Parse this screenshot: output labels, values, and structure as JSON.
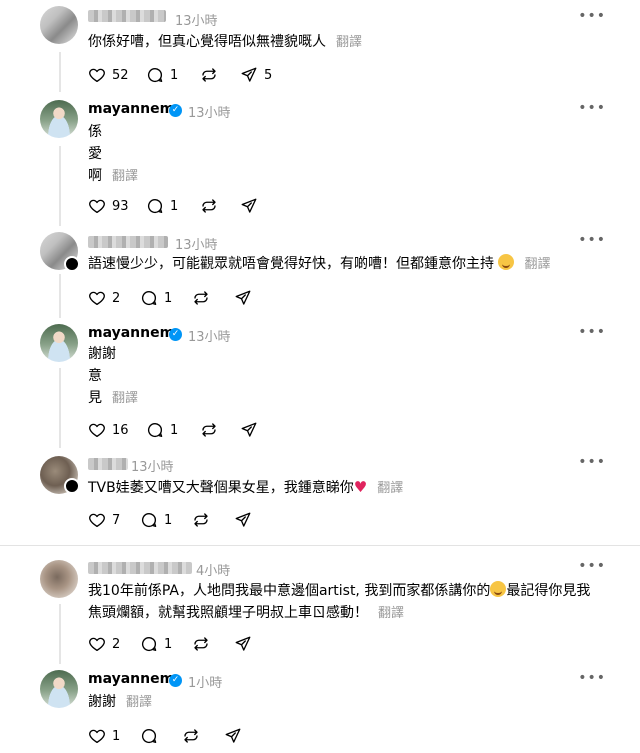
{
  "posts": [
    {
      "time": "13小時",
      "text": "你係好嘈，但真心覺得唔似無禮貌嘅人",
      "translate": "翻譯",
      "likes": "52",
      "comments": "1",
      "shares": "5"
    },
    {
      "user": "mayannem",
      "time": "13小時",
      "lines": [
        "係",
        "愛",
        "啊"
      ],
      "translate": "翻譯",
      "likes": "93",
      "comments": "1"
    },
    {
      "time": "13小時",
      "text": "語速慢少少，可能觀眾就唔會覺得好快，有啲嘈！但都鍾意你主持",
      "translate": "翻譯",
      "likes": "2",
      "comments": "1"
    },
    {
      "user": "mayannem",
      "time": "13小時",
      "lines": [
        "謝謝",
        "意",
        "見"
      ],
      "translate": "翻譯",
      "likes": "16",
      "comments": "1"
    },
    {
      "time": "13小時",
      "text": "TVB娃萎又嘈又大聲個果女星，我鍾意睇你",
      "translate": "翻譯",
      "likes": "7",
      "comments": "1"
    },
    {
      "time": "4小時",
      "text1": "我10年前係PA，人地問我最中意邊個artist, 我到而家都係講你的",
      "text1b": "最記得你見我",
      "text2": "焦頭爛額，就幫我照顧埋子明叔上車ㄖ感動！",
      "translate": "翻譯",
      "likes": "2",
      "comments": "1"
    },
    {
      "user": "mayannem",
      "time": "1小時",
      "text": "謝謝",
      "translate": "翻譯",
      "likes": "1"
    }
  ],
  "icons": {
    "like": "heart-outline-icon",
    "comment": "comment-bubble-icon",
    "repost": "repost-arrows-icon",
    "share": "paper-plane-icon",
    "more": "more-dots-icon",
    "verified": "verified-badge-icon"
  },
  "colors": {
    "verified": "#0095f6",
    "muted": "#999999",
    "heart": "#e0245e"
  }
}
